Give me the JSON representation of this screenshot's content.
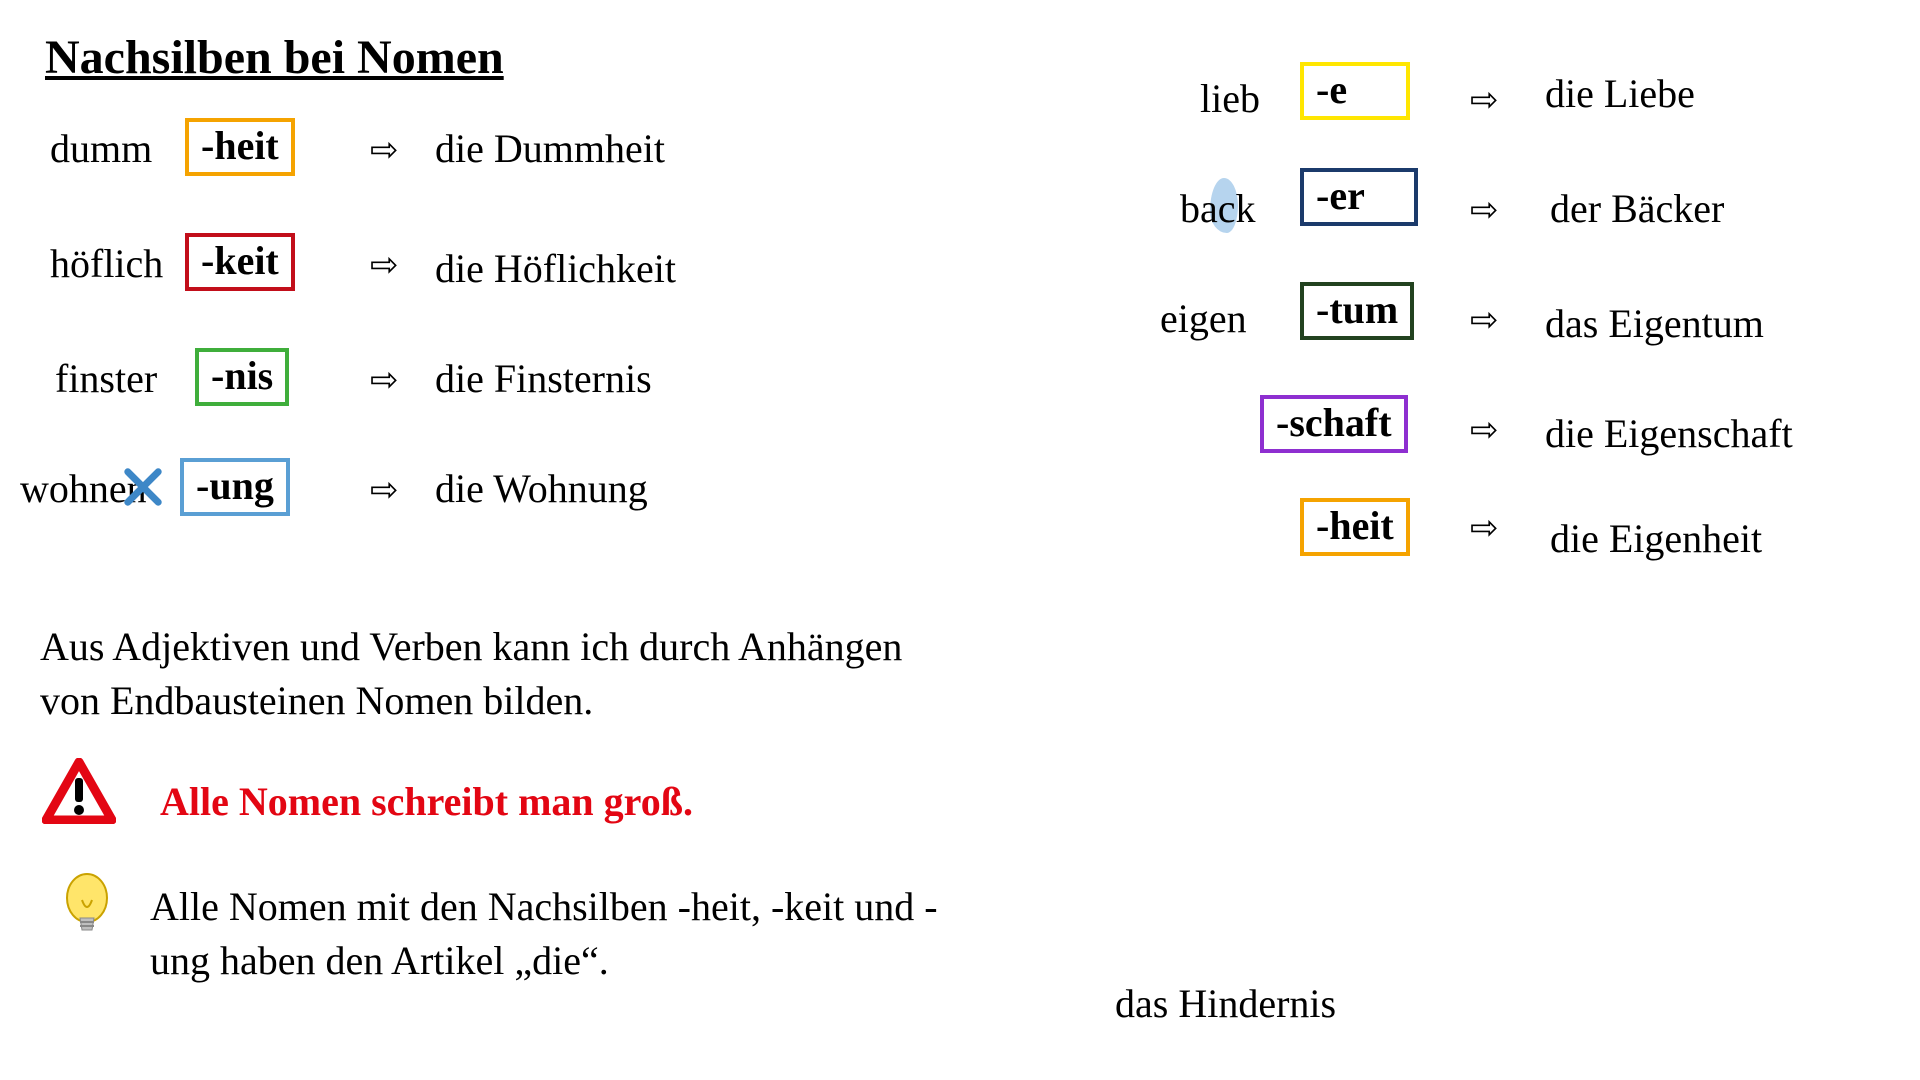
{
  "title": "Nachsilben bei Nomen",
  "arrow": "⇨",
  "left_rows": [
    {
      "base": "dumm",
      "suffix": "-heit",
      "color": "#f5a300",
      "result": "die Dummheit"
    },
    {
      "base": "höflich",
      "suffix": "-keit",
      "color": "#c20e1a",
      "result": "die Höflichkeit"
    },
    {
      "base": "finster",
      "suffix": "-nis",
      "color": "#3fae3b",
      "result": "die Finsternis"
    },
    {
      "base": "wohnen",
      "suffix": "-ung",
      "color": "#5a9fd4",
      "result": "die Wohnung",
      "cross": true
    }
  ],
  "right_rows": [
    {
      "base": "lieb",
      "suffix": "-e",
      "color": "#ffe600",
      "result": "die Liebe"
    },
    {
      "base": "back",
      "suffix": "-er",
      "color": "#1b3a6b",
      "result": "der Bäcker",
      "highlight": true
    },
    {
      "base": "eigen",
      "suffix": "-tum",
      "color": "#22421f",
      "result": "das Eigentum"
    },
    {
      "base": "",
      "suffix": "-schaft",
      "color": "#8e2fd0",
      "result": "die Eigenschaft"
    },
    {
      "base": "",
      "suffix": "-heit",
      "color": "#f5a300",
      "result": "die Eigenheit"
    }
  ],
  "paragraph": "Aus Adjektiven und Verben kann ich durch Anhängen von Endbausteinen Nomen bilden.",
  "warning_text": "Alle Nomen schreibt man groß.",
  "tip_text": "Alle Nomen mit den Nachsilben -heit, -keit und -ung haben den Artikel „die“.",
  "footnote": "das Hindernis"
}
